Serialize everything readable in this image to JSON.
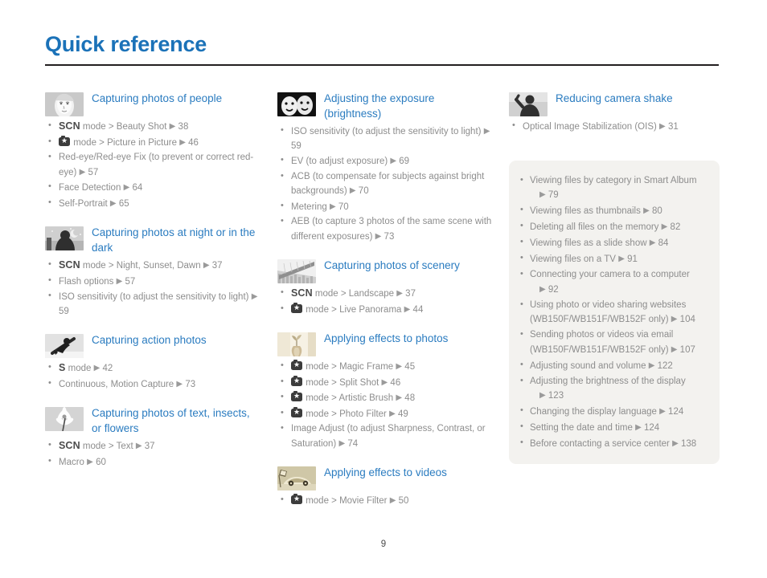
{
  "title": "Quick reference",
  "page_number": "9",
  "colors": {
    "title_blue": "#1b72b8",
    "section_blue": "#2b7cc0",
    "body_gray": "#8d8d8d",
    "rule_black": "#231f20",
    "tip_box_bg": "#f3f2ef"
  },
  "columns": [
    {
      "sections": [
        {
          "icon": "portrait-woman-icon",
          "title": "Capturing photos of people",
          "items": [
            {
              "prefix_mode": "SCN",
              "text": "mode > Beauty Shot",
              "page": "38"
            },
            {
              "prefix_mode": "smart-camera",
              "text": "mode > Picture in Picture",
              "page": "46"
            },
            {
              "text": "Red-eye/Red-eye Fix (to prevent or correct red-eye)",
              "page": "57"
            },
            {
              "text": "Face Detection",
              "page": "64"
            },
            {
              "text": "Self-Portrait",
              "page": "65"
            }
          ]
        },
        {
          "icon": "night-moon-person-icon",
          "title": "Capturing photos at night or in the dark",
          "items": [
            {
              "prefix_mode": "SCN",
              "text": "mode > Night, Sunset, Dawn",
              "page": "37"
            },
            {
              "text": "Flash options",
              "page": "57"
            },
            {
              "text": "ISO sensitivity (to adjust the sensitivity to light)",
              "page": "59"
            }
          ]
        },
        {
          "icon": "snowboarder-action-icon",
          "title": "Capturing action photos",
          "items": [
            {
              "prefix_mode": "S",
              "text": "mode",
              "page": "42"
            },
            {
              "text": "Continuous, Motion Capture",
              "page": "73"
            }
          ]
        },
        {
          "icon": "flower-macro-icon",
          "title": "Capturing photos of text, insects, or flowers",
          "items": [
            {
              "prefix_mode": "SCN",
              "text": "mode > Text",
              "page": "37"
            },
            {
              "text": "Macro",
              "page": "60"
            }
          ]
        }
      ]
    },
    {
      "sections": [
        {
          "icon": "two-faces-exposure-icon",
          "title": "Adjusting the exposure (brightness)",
          "items": [
            {
              "text": "ISO sensitivity (to adjust the sensitivity to light)",
              "page": "59"
            },
            {
              "text": "EV (to adjust exposure)",
              "page": "69"
            },
            {
              "text": "ACB (to compensate for subjects against bright backgrounds)",
              "page": "70"
            },
            {
              "text": "Metering",
              "page": "70"
            },
            {
              "text": "AEB (to capture 3 photos of the same scene with different exposures)",
              "page": "73"
            }
          ]
        },
        {
          "icon": "bridge-cityscape-icon",
          "title": "Capturing photos of scenery",
          "items": [
            {
              "prefix_mode": "SCN",
              "text": "mode > Landscape",
              "page": "37"
            },
            {
              "prefix_mode": "smart-camera",
              "text": "mode > Live Panorama",
              "page": "44"
            }
          ]
        },
        {
          "icon": "vase-flowers-effects-icon",
          "title": "Applying effects to photos",
          "items": [
            {
              "prefix_mode": "smart-camera",
              "text": "mode > Magic Frame",
              "page": "45"
            },
            {
              "prefix_mode": "smart-camera",
              "text": "mode > Split Shot",
              "page": "46"
            },
            {
              "prefix_mode": "smart-camera",
              "text": "mode > Artistic Brush",
              "page": "48"
            },
            {
              "prefix_mode": "smart-camera",
              "text": "mode > Photo Filter",
              "page": "49"
            },
            {
              "text": "Image Adjust (to adjust Sharpness, Contrast, or Saturation)",
              "page": "74"
            }
          ]
        },
        {
          "icon": "car-video-effects-icon",
          "title": "Applying effects to videos",
          "items": [
            {
              "prefix_mode": "smart-camera",
              "text": "mode > Movie Filter",
              "page": "50"
            }
          ]
        }
      ]
    },
    {
      "sections": [
        {
          "icon": "camera-shake-person-icon",
          "title": "Reducing camera shake",
          "items": [
            {
              "text": "Optical Image Stabilization (OIS)",
              "page": "31"
            }
          ]
        }
      ],
      "tip_box": {
        "items": [
          {
            "text": "Viewing files by category in Smart Album",
            "page": "79",
            "wrap_page": true
          },
          {
            "text": "Viewing files as thumbnails",
            "page": "80"
          },
          {
            "text": "Deleting all files on the memory",
            "page": "82"
          },
          {
            "text": "Viewing files as a slide show",
            "page": "84"
          },
          {
            "text": "Viewing files on a TV",
            "page": "91"
          },
          {
            "text": "Connecting your camera to a computer",
            "page": "92",
            "wrap_page": true
          },
          {
            "text": "Using photo or video sharing websites (WB150F/WB151F/WB152F only)",
            "page": "104"
          },
          {
            "text": "Sending photos or videos via email (WB150F/WB151F/WB152F only)",
            "page": "107"
          },
          {
            "text": "Adjusting sound and volume",
            "page": "122"
          },
          {
            "text": "Adjusting the brightness of the display",
            "page": "123",
            "wrap_page": true
          },
          {
            "text": "Changing the display language",
            "page": "124"
          },
          {
            "text": "Setting the date and time",
            "page": "124"
          },
          {
            "text": "Before contacting a service center",
            "page": "138"
          }
        ]
      }
    }
  ]
}
